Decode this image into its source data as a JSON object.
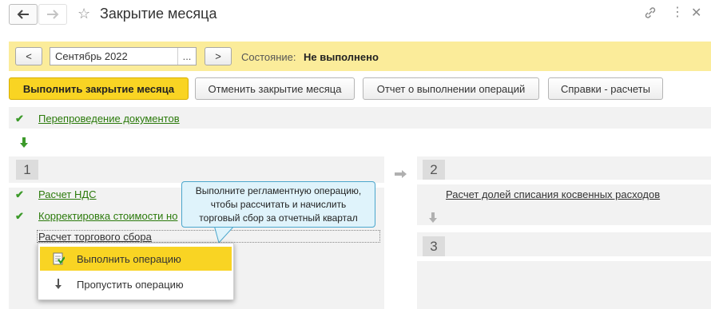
{
  "window": {
    "title": "Закрытие месяца"
  },
  "header_icons": {
    "star": "star-icon",
    "link": "link-icon",
    "more": "more-icon",
    "close": "close-icon"
  },
  "period": {
    "prev_label": "<",
    "next_label": ">",
    "value": "Сентябрь 2022",
    "select_label": "...",
    "status_label": "Состояние:",
    "status_value": "Не выполнено"
  },
  "toolbar": {
    "run": "Выполнить закрытие месяца",
    "cancel": "Отменить закрытие месяца",
    "report": "Отчет о выполнении операций",
    "help": "Справки - расчеты"
  },
  "steps": {
    "repost": "Перепроведение документов",
    "block1_number": "1",
    "vat": "Расчет НДС",
    "correction": "Корректировка стоимости но",
    "trade_fee": "Расчет торгового сбора",
    "block2_number": "2",
    "indirect": "Расчет долей списания косвенных расходов",
    "block3_number": "3"
  },
  "tooltip": {
    "line1": "Выполните регламентную операцию,",
    "line2": "чтобы рассчитать и начислить",
    "line3": "торговый сбор за отчетный квартал"
  },
  "context_menu": {
    "execute": "Выполнить операцию",
    "skip": "Пропустить операцию"
  },
  "colors": {
    "accent_yellow": "#f9d423",
    "bar_yellow": "#fbec9a",
    "link_green": "#2b7a0b",
    "tooltip_bg": "#dff3fb"
  }
}
